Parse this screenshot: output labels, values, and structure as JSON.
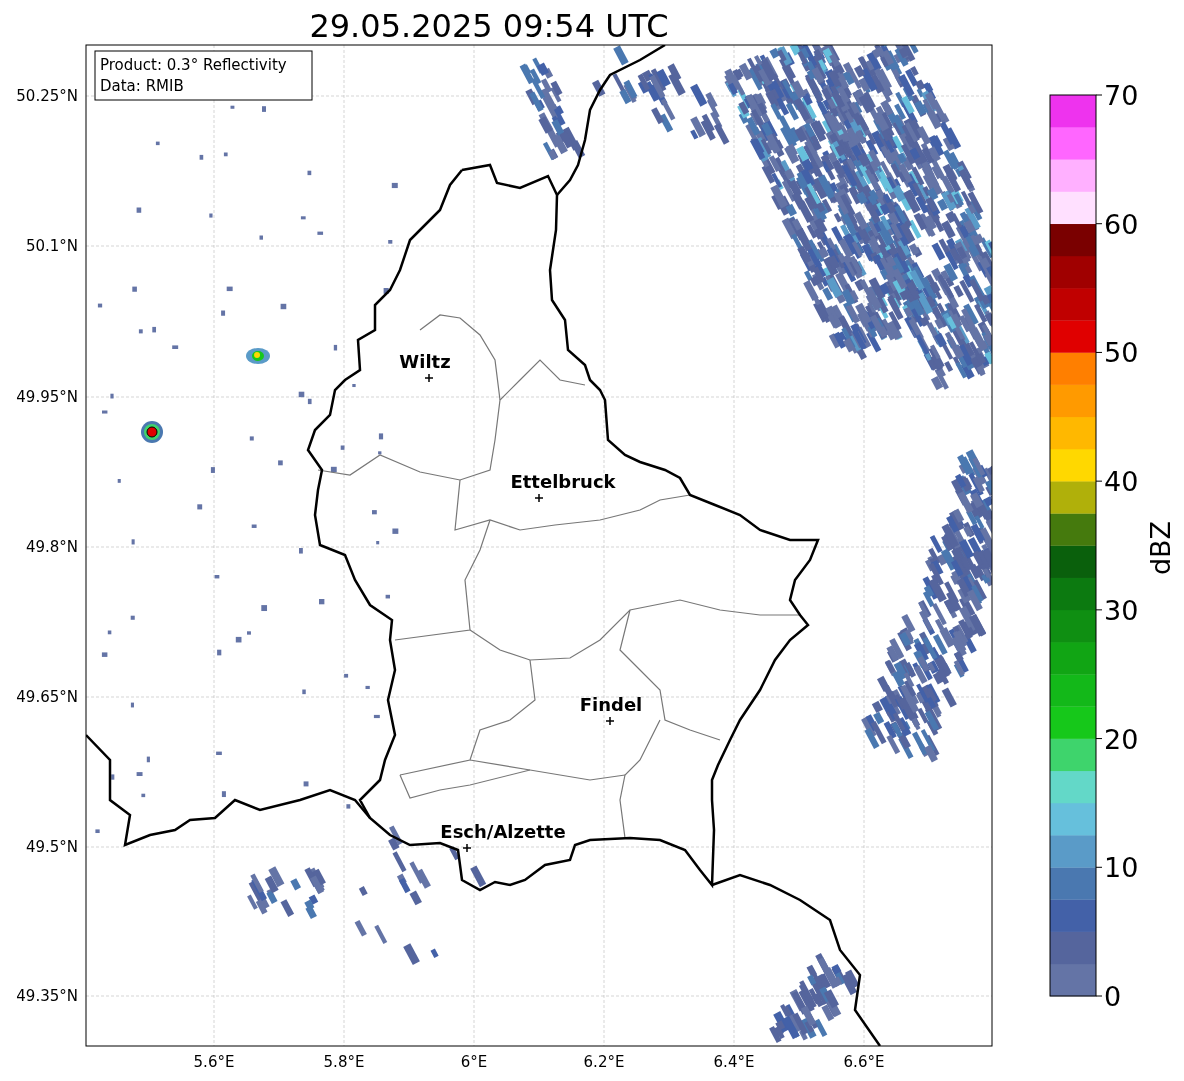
{
  "title": "29.05.2025 09:54 UTC",
  "info_box": [
    "Product: 0.3° Reflectivity",
    "Data: RMIB"
  ],
  "map": {
    "lat_ticks": [
      "50.25°N",
      "50.1°N",
      "49.95°N",
      "49.8°N",
      "49.65°N",
      "49.5°N",
      "49.35°N"
    ],
    "lon_ticks": [
      "5.6°E",
      "5.8°E",
      "6°E",
      "6.2°E",
      "6.4°E",
      "6.6°E"
    ],
    "cities": [
      {
        "name": "Wiltz"
      },
      {
        "name": "Ettelbruck"
      },
      {
        "name": "Findel"
      },
      {
        "name": "Esch/Alzette"
      }
    ]
  },
  "colorbar": {
    "label": "dBZ",
    "ticks": [
      "70",
      "60",
      "50",
      "40",
      "30",
      "20",
      "10",
      "0"
    ],
    "bins": [
      {
        "color": "#6474a6"
      },
      {
        "color": "#55659d"
      },
      {
        "color": "#4361a8"
      },
      {
        "color": "#4a78b0"
      },
      {
        "color": "#5a9bc8"
      },
      {
        "color": "#66c0dc"
      },
      {
        "color": "#63d8c8"
      },
      {
        "color": "#3ed46c"
      },
      {
        "color": "#16c81a"
      },
      {
        "color": "#13b819"
      },
      {
        "color": "#11a514"
      },
      {
        "color": "#0f8f12"
      },
      {
        "color": "#0c7a10"
      },
      {
        "color": "#0a600c"
      },
      {
        "color": "#457a0d"
      },
      {
        "color": "#b0b00a"
      },
      {
        "color": "#ffd800"
      },
      {
        "color": "#ffb800"
      },
      {
        "color": "#ff9a00"
      },
      {
        "color": "#ff7f00"
      },
      {
        "color": "#e00000"
      },
      {
        "color": "#c00000"
      },
      {
        "color": "#a00000"
      },
      {
        "color": "#7a0000"
      },
      {
        "color": "#ffe0ff"
      },
      {
        "color": "#ffb0ff"
      },
      {
        "color": "#ff66ff"
      },
      {
        "color": "#ee33ee"
      }
    ]
  }
}
